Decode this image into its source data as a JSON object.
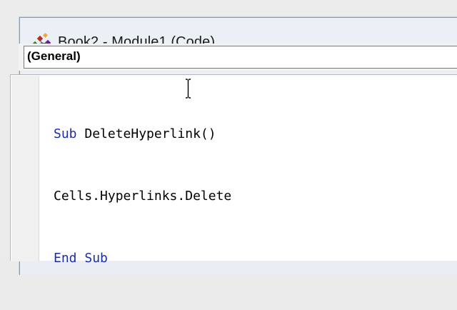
{
  "window": {
    "title": "Book2 - Module1 (Code)",
    "icon": "vba-module-icon"
  },
  "object_combo": {
    "value": "(General)"
  },
  "code_editor": {
    "line1": {
      "keyword": "Sub",
      "rest": "DeleteHyperlink()"
    },
    "line2": {
      "text": "Cells.Hyperlinks.Delete"
    },
    "line3": {
      "keyword1": "End",
      "keyword2": "Sub"
    }
  },
  "colors": {
    "keyword": "#1a2ea8",
    "code_text": "#000000",
    "code_background": "#ffffff"
  }
}
